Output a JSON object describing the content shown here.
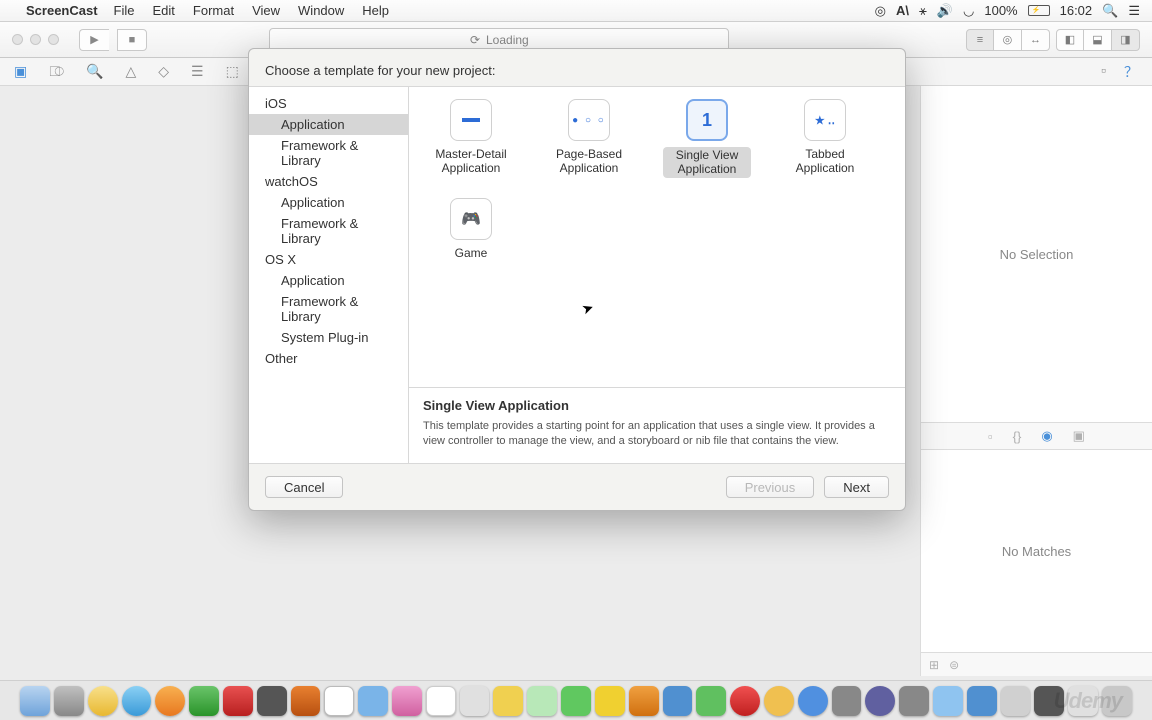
{
  "menubar": {
    "app": "ScreenCast",
    "items": [
      "File",
      "Edit",
      "Format",
      "View",
      "Window",
      "Help"
    ],
    "status": {
      "battery": "100%",
      "time": "16:02"
    }
  },
  "toolbar": {
    "loading": "Loading"
  },
  "right_panel": {
    "no_selection": "No Selection",
    "no_matches": "No Matches"
  },
  "dialog": {
    "title": "Choose a template for your new project:",
    "sidebar": [
      {
        "category": "iOS",
        "items": [
          "Application",
          "Framework & Library"
        ],
        "selected": 0
      },
      {
        "category": "watchOS",
        "items": [
          "Application",
          "Framework & Library"
        ]
      },
      {
        "category": "OS X",
        "items": [
          "Application",
          "Framework & Library",
          "System Plug-in"
        ]
      },
      {
        "category": "Other",
        "items": []
      }
    ],
    "templates": [
      {
        "name": "Master-Detail Application",
        "icon": "master-detail"
      },
      {
        "name": "Page-Based Application",
        "icon": "page-based"
      },
      {
        "name": "Single View Application",
        "icon": "single-view",
        "selected": true
      },
      {
        "name": "Tabbed Application",
        "icon": "tabbed"
      },
      {
        "name": "Game",
        "icon": "game"
      }
    ],
    "description": {
      "title": "Single View Application",
      "text": "This template provides a starting point for an application that uses a single view. It provides a view controller to manage the view, and a storyboard or nib file that contains the view."
    },
    "buttons": {
      "cancel": "Cancel",
      "previous": "Previous",
      "next": "Next"
    }
  },
  "watermark": "Udemy"
}
